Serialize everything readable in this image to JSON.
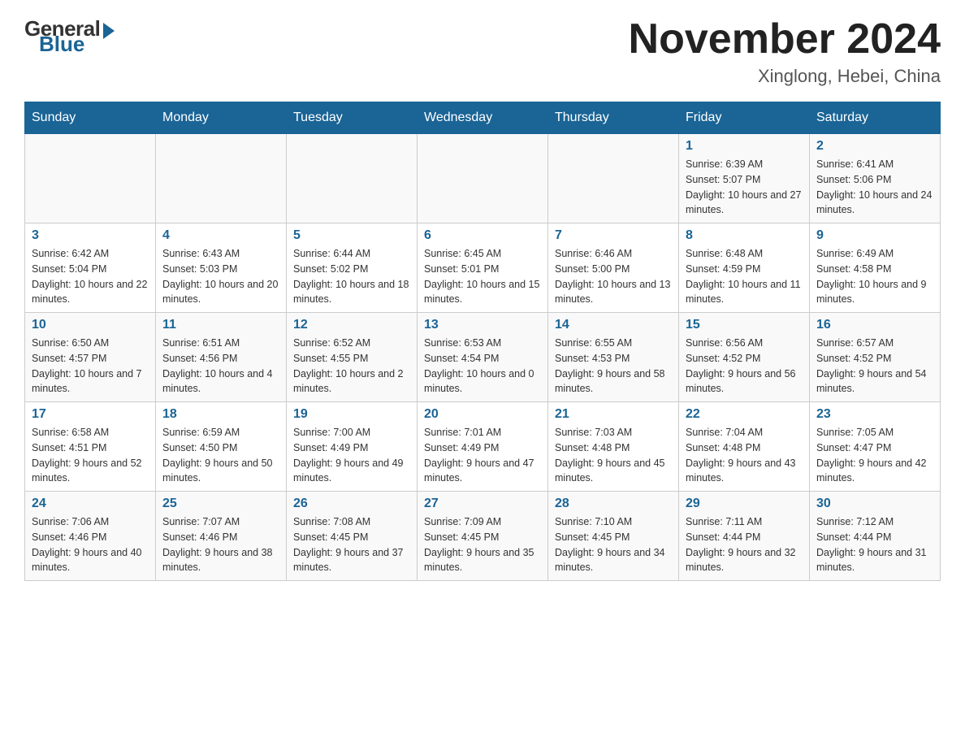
{
  "header": {
    "logo_general": "General",
    "logo_blue": "Blue",
    "title": "November 2024",
    "subtitle": "Xinglong, Hebei, China"
  },
  "weekdays": [
    "Sunday",
    "Monday",
    "Tuesday",
    "Wednesday",
    "Thursday",
    "Friday",
    "Saturday"
  ],
  "weeks": [
    [
      {
        "day": "",
        "info": ""
      },
      {
        "day": "",
        "info": ""
      },
      {
        "day": "",
        "info": ""
      },
      {
        "day": "",
        "info": ""
      },
      {
        "day": "",
        "info": ""
      },
      {
        "day": "1",
        "info": "Sunrise: 6:39 AM\nSunset: 5:07 PM\nDaylight: 10 hours and 27 minutes."
      },
      {
        "day": "2",
        "info": "Sunrise: 6:41 AM\nSunset: 5:06 PM\nDaylight: 10 hours and 24 minutes."
      }
    ],
    [
      {
        "day": "3",
        "info": "Sunrise: 6:42 AM\nSunset: 5:04 PM\nDaylight: 10 hours and 22 minutes."
      },
      {
        "day": "4",
        "info": "Sunrise: 6:43 AM\nSunset: 5:03 PM\nDaylight: 10 hours and 20 minutes."
      },
      {
        "day": "5",
        "info": "Sunrise: 6:44 AM\nSunset: 5:02 PM\nDaylight: 10 hours and 18 minutes."
      },
      {
        "day": "6",
        "info": "Sunrise: 6:45 AM\nSunset: 5:01 PM\nDaylight: 10 hours and 15 minutes."
      },
      {
        "day": "7",
        "info": "Sunrise: 6:46 AM\nSunset: 5:00 PM\nDaylight: 10 hours and 13 minutes."
      },
      {
        "day": "8",
        "info": "Sunrise: 6:48 AM\nSunset: 4:59 PM\nDaylight: 10 hours and 11 minutes."
      },
      {
        "day": "9",
        "info": "Sunrise: 6:49 AM\nSunset: 4:58 PM\nDaylight: 10 hours and 9 minutes."
      }
    ],
    [
      {
        "day": "10",
        "info": "Sunrise: 6:50 AM\nSunset: 4:57 PM\nDaylight: 10 hours and 7 minutes."
      },
      {
        "day": "11",
        "info": "Sunrise: 6:51 AM\nSunset: 4:56 PM\nDaylight: 10 hours and 4 minutes."
      },
      {
        "day": "12",
        "info": "Sunrise: 6:52 AM\nSunset: 4:55 PM\nDaylight: 10 hours and 2 minutes."
      },
      {
        "day": "13",
        "info": "Sunrise: 6:53 AM\nSunset: 4:54 PM\nDaylight: 10 hours and 0 minutes."
      },
      {
        "day": "14",
        "info": "Sunrise: 6:55 AM\nSunset: 4:53 PM\nDaylight: 9 hours and 58 minutes."
      },
      {
        "day": "15",
        "info": "Sunrise: 6:56 AM\nSunset: 4:52 PM\nDaylight: 9 hours and 56 minutes."
      },
      {
        "day": "16",
        "info": "Sunrise: 6:57 AM\nSunset: 4:52 PM\nDaylight: 9 hours and 54 minutes."
      }
    ],
    [
      {
        "day": "17",
        "info": "Sunrise: 6:58 AM\nSunset: 4:51 PM\nDaylight: 9 hours and 52 minutes."
      },
      {
        "day": "18",
        "info": "Sunrise: 6:59 AM\nSunset: 4:50 PM\nDaylight: 9 hours and 50 minutes."
      },
      {
        "day": "19",
        "info": "Sunrise: 7:00 AM\nSunset: 4:49 PM\nDaylight: 9 hours and 49 minutes."
      },
      {
        "day": "20",
        "info": "Sunrise: 7:01 AM\nSunset: 4:49 PM\nDaylight: 9 hours and 47 minutes."
      },
      {
        "day": "21",
        "info": "Sunrise: 7:03 AM\nSunset: 4:48 PM\nDaylight: 9 hours and 45 minutes."
      },
      {
        "day": "22",
        "info": "Sunrise: 7:04 AM\nSunset: 4:48 PM\nDaylight: 9 hours and 43 minutes."
      },
      {
        "day": "23",
        "info": "Sunrise: 7:05 AM\nSunset: 4:47 PM\nDaylight: 9 hours and 42 minutes."
      }
    ],
    [
      {
        "day": "24",
        "info": "Sunrise: 7:06 AM\nSunset: 4:46 PM\nDaylight: 9 hours and 40 minutes."
      },
      {
        "day": "25",
        "info": "Sunrise: 7:07 AM\nSunset: 4:46 PM\nDaylight: 9 hours and 38 minutes."
      },
      {
        "day": "26",
        "info": "Sunrise: 7:08 AM\nSunset: 4:45 PM\nDaylight: 9 hours and 37 minutes."
      },
      {
        "day": "27",
        "info": "Sunrise: 7:09 AM\nSunset: 4:45 PM\nDaylight: 9 hours and 35 minutes."
      },
      {
        "day": "28",
        "info": "Sunrise: 7:10 AM\nSunset: 4:45 PM\nDaylight: 9 hours and 34 minutes."
      },
      {
        "day": "29",
        "info": "Sunrise: 7:11 AM\nSunset: 4:44 PM\nDaylight: 9 hours and 32 minutes."
      },
      {
        "day": "30",
        "info": "Sunrise: 7:12 AM\nSunset: 4:44 PM\nDaylight: 9 hours and 31 minutes."
      }
    ]
  ],
  "colors": {
    "header_bg": "#1a6496",
    "accent_blue": "#1a6496"
  }
}
